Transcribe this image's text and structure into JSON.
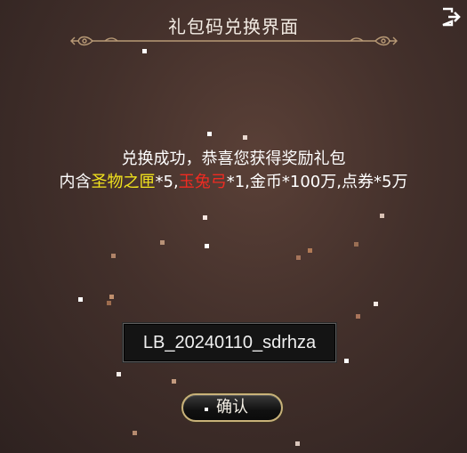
{
  "dialog": {
    "title": "礼包码兑换界面",
    "success_line": "兑换成功，恭喜您获得奖励礼包",
    "contents": {
      "prefix": "内含",
      "item1": "圣物之匣",
      "item1_qty": "*5,",
      "item2": "玉兔弓",
      "item2_qty": "*1,金币*100万,点券*5万"
    },
    "code_value": "LB_20240110_sdrhza",
    "confirm_label": "确认"
  },
  "colors": {
    "highlight_yellow": "#f2e41d",
    "highlight_red": "#ef2b22",
    "ornament_gold": "#b89a76"
  },
  "icons": {
    "exit": "logout-icon",
    "ornament": "ornamental-divider"
  }
}
